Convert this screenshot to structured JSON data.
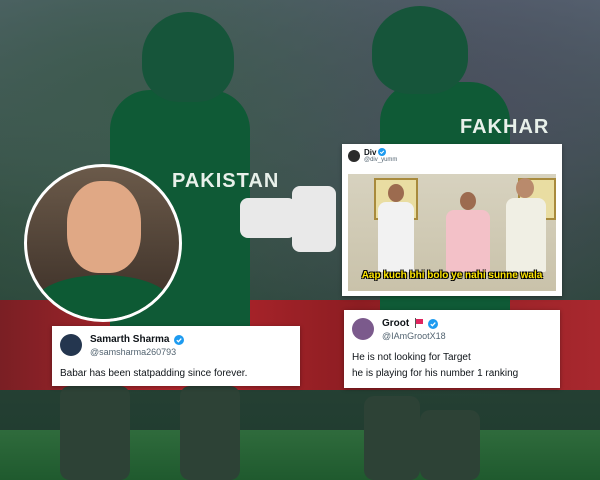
{
  "background": {
    "jersey_left": "PAKISTAN",
    "jersey_right": "FAKHAR",
    "colors": {
      "kit_green": "#0f5a36",
      "board_red": "#b4262d"
    }
  },
  "tweets": [
    {
      "name": "Samarth Sharma",
      "handle": "@samsharma260793",
      "text": "Babar has been statpadding since forever.",
      "verified": true
    },
    {
      "name": "Groot",
      "handle": "@IAmGrootX18",
      "text_lines": [
        "He is not looking for Target",
        "he is playing for his number 1 ranking"
      ],
      "verified": true,
      "flag_icon": "india-flag-icon"
    }
  ],
  "meme_tweet": {
    "name": "Div",
    "handle": "@div_yumm",
    "verified": true,
    "caption": "Aap kuch bhi bolo ye nahi sunne wala"
  },
  "accent_blue": "#1d9bf0"
}
